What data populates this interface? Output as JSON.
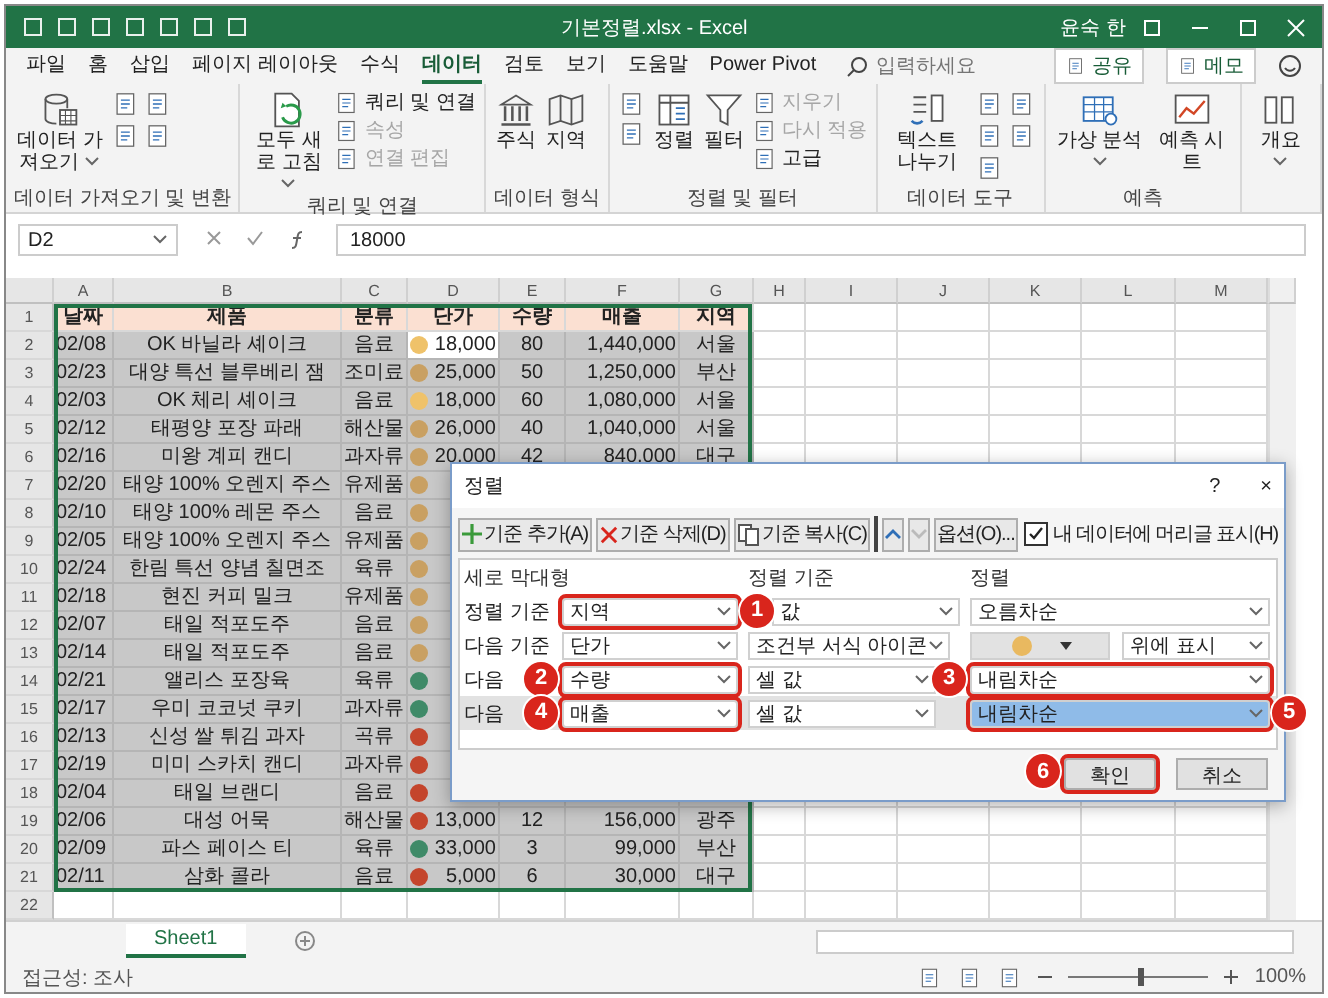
{
  "window": {
    "title": "기본정렬.xlsx - Excel",
    "user": "윤숙 한"
  },
  "ribbon_tabs": [
    {
      "label": "파일",
      "selected": false
    },
    {
      "label": "홈",
      "selected": false
    },
    {
      "label": "삽입",
      "selected": false
    },
    {
      "label": "페이지 레이아웃",
      "selected": false
    },
    {
      "label": "수식",
      "selected": false
    },
    {
      "label": "데이터",
      "selected": true
    },
    {
      "label": "검토",
      "selected": false
    },
    {
      "label": "보기",
      "selected": false
    },
    {
      "label": "도움말",
      "selected": false
    },
    {
      "label": "Power Pivot",
      "selected": false
    }
  ],
  "search": {
    "placeholder": "입력하세요"
  },
  "share_button": "공유",
  "memo_button": "메모",
  "ribbon_groups": [
    {
      "label": "데이터 가져오기 및 변환",
      "items": [
        {
          "label": "데이터 가져오기",
          "kind": "large",
          "dropdown": true,
          "disabled": false
        }
      ]
    },
    {
      "label": "쿼리 및 연결",
      "items": [
        {
          "label": "모두 새로 고침",
          "kind": "large",
          "dropdown": true,
          "disabled": false
        },
        {
          "label": "쿼리 및 연결",
          "kind": "small",
          "disabled": false
        },
        {
          "label": "속성",
          "kind": "small",
          "disabled": true
        },
        {
          "label": "연결 편집",
          "kind": "small",
          "disabled": true
        }
      ]
    },
    {
      "label": "데이터 형식",
      "items": [
        {
          "label": "주식",
          "kind": "large",
          "dropdown": false,
          "disabled": false
        },
        {
          "label": "지역",
          "kind": "large",
          "dropdown": false,
          "disabled": false
        }
      ]
    },
    {
      "label": "정렬 및 필터",
      "items": [
        {
          "label": "정렬",
          "kind": "large",
          "dropdown": false,
          "disabled": false
        },
        {
          "label": "필터",
          "kind": "large",
          "dropdown": false,
          "disabled": false
        },
        {
          "label": "지우기",
          "kind": "small",
          "disabled": true
        },
        {
          "label": "다시 적용",
          "kind": "small",
          "disabled": true
        },
        {
          "label": "고급",
          "kind": "small",
          "disabled": false
        }
      ]
    },
    {
      "label": "데이터 도구",
      "items": [
        {
          "label": "텍스트 나누기",
          "kind": "large",
          "dropdown": false,
          "disabled": false
        }
      ]
    },
    {
      "label": "예측",
      "items": [
        {
          "label": "가상 분석",
          "kind": "large",
          "dropdown": true,
          "disabled": false
        },
        {
          "label": "예측 시트",
          "kind": "large",
          "dropdown": false,
          "disabled": false
        }
      ]
    },
    {
      "items": [
        {
          "label": "개요",
          "kind": "large",
          "dropdown": true,
          "disabled": false
        }
      ]
    }
  ],
  "formula_bar": {
    "name_box": "D2",
    "formula": "18000"
  },
  "sheet": {
    "columns": [
      "A",
      "B",
      "C",
      "D",
      "E",
      "F",
      "G",
      "H",
      "I",
      "J",
      "K",
      "L",
      "M"
    ],
    "row_numbers": [
      "1",
      "2",
      "3",
      "4",
      "5",
      "6",
      "7",
      "8",
      "9",
      "10",
      "11",
      "12",
      "13",
      "14",
      "15",
      "16",
      "17",
      "18",
      "19",
      "20",
      "21",
      "22"
    ],
    "header": [
      "날짜",
      "제품",
      "분류",
      "단가",
      "수량",
      "매출",
      "지역"
    ],
    "rows": [
      {
        "cells": [
          "02/08",
          "OK 바닐라 셰이크",
          "음료",
          "18,000",
          "80",
          "1,440,000",
          "서울"
        ],
        "color": "#efc26a",
        "active": true
      },
      {
        "cells": [
          "02/23",
          "대양 특선 블루베리 잼",
          "조미료",
          "25,000",
          "50",
          "1,250,000",
          "부산"
        ],
        "color": "#c9a062",
        "active": false
      },
      {
        "cells": [
          "02/03",
          "OK 체리 셰이크",
          "음료",
          "18,000",
          "60",
          "1,080,000",
          "서울"
        ],
        "color": "#efc26a",
        "active": false
      },
      {
        "cells": [
          "02/12",
          "태평양 포장 파래",
          "해산물",
          "26,000",
          "40",
          "1,040,000",
          "서울"
        ],
        "color": "#c9a062",
        "active": false
      },
      {
        "cells": [
          "02/16",
          "미왕 계피 캔디",
          "과자류",
          "20,000",
          "42",
          "840,000",
          "대구"
        ],
        "color": "#c9a062",
        "active": false
      },
      {
        "cells": [
          "02/20",
          "태양 100% 오렌지 주스",
          "유제품"
        ],
        "color": "#c9a062",
        "active": false
      },
      {
        "cells": [
          "02/10",
          "태양 100% 레몬 주스",
          "음료"
        ],
        "color": "#c9a062",
        "active": false
      },
      {
        "cells": [
          "02/05",
          "태양 100% 오렌지 주스",
          "유제품"
        ],
        "color": "#c9a062",
        "active": false
      },
      {
        "cells": [
          "02/24",
          "한림 특선 양념 칠면조",
          "육류"
        ],
        "color": "#c9a062",
        "active": false
      },
      {
        "cells": [
          "02/18",
          "현진 커피 밀크",
          "유제품"
        ],
        "color": "#c9a062",
        "active": false
      },
      {
        "cells": [
          "02/07",
          "태일 적포도주",
          "음료"
        ],
        "color": "#c9a062",
        "active": false
      },
      {
        "cells": [
          "02/14",
          "태일 적포도주",
          "음료"
        ],
        "color": "#c9a062",
        "active": false
      },
      {
        "cells": [
          "02/21",
          "앨리스 포장육",
          "육류"
        ],
        "color": "#3f8a68",
        "active": false
      },
      {
        "cells": [
          "02/17",
          "우미 코코넛 쿠키",
          "과자류"
        ],
        "color": "#3f8a68",
        "active": false
      },
      {
        "cells": [
          "02/13",
          "신성 쌀 튀김 과자",
          "곡류"
        ],
        "color": "#c4452c",
        "active": false
      },
      {
        "cells": [
          "02/19",
          "미미 스카치 캔디",
          "과자류"
        ],
        "color": "#c4452c",
        "active": false
      },
      {
        "cells": [
          "02/04",
          "태일 브랜디",
          "음료"
        ],
        "color": "#c4452c",
        "active": false
      },
      {
        "cells": [
          "02/06",
          "대성 어묵",
          "해산물",
          "13,000",
          "12",
          "156,000",
          "광주"
        ],
        "color": "#c4452c",
        "active": false
      },
      {
        "cells": [
          "02/09",
          "파스 페이스 티",
          "육류",
          "33,000",
          "3",
          "99,000",
          "부산"
        ],
        "color": "#3f8a68",
        "active": false
      },
      {
        "cells": [
          "02/11",
          "삼화 콜라",
          "음료",
          "5,000",
          "6",
          "30,000",
          "대구"
        ],
        "color": "#c4452c",
        "active": false
      }
    ]
  },
  "dialog": {
    "title": "정렬",
    "help": "?",
    "close": "×",
    "toolbar": [
      {
        "kind": "add",
        "label": "기준 추가(A)",
        "disabled": false
      },
      {
        "kind": "delete",
        "label": "기준 삭제(D)",
        "disabled": false
      },
      {
        "kind": "copy",
        "label": "기준 복사(C)",
        "disabled": false
      },
      {
        "kind": "up",
        "disabled": false
      },
      {
        "kind": "down",
        "disabled": true
      },
      {
        "kind": "text",
        "label": "옵션(O)...",
        "disabled": false
      }
    ],
    "header_checkbox": {
      "label": "내 데이터에 머리글 표시(H)",
      "checked": true
    },
    "columns": [
      "세로 막대형",
      "정렬 기준",
      "정렬"
    ],
    "levels": [
      {
        "label": "정렬 기준",
        "selected": false,
        "column": {
          "value": "지역",
          "highlighted": true,
          "badge": "1"
        },
        "sort_on": {
          "value": "값"
        },
        "order": {
          "kind": "text",
          "value": "오름차순",
          "highlighted": false,
          "selected": false
        }
      },
      {
        "label": "다음 기준",
        "selected": false,
        "column": {
          "value": "단가",
          "highlighted": false
        },
        "sort_on": {
          "value": "조건부 서식 아이콘"
        },
        "order": {
          "kind": "icon",
          "color": "#e9b960",
          "position": "위에 표시",
          "highlighted": false,
          "selected": false
        }
      },
      {
        "label": "다음",
        "selected": false,
        "column": {
          "value": "수량",
          "highlighted": true,
          "badge": "2"
        },
        "sort_on": {
          "value": "셀 값"
        },
        "order": {
          "kind": "text",
          "value": "내림차순",
          "highlighted": true,
          "selected": false,
          "badge": "3"
        }
      },
      {
        "label": "다음",
        "selected": true,
        "column": {
          "value": "매출",
          "highlighted": true,
          "badge": "4"
        },
        "sort_on": {
          "value": "셀 값"
        },
        "order": {
          "kind": "text",
          "value": "내림차순",
          "highlighted": true,
          "selected": true,
          "badge": "5"
        }
      }
    ],
    "buttons": [
      {
        "label": "확인",
        "highlighted": true,
        "badge": "6"
      },
      {
        "label": "취소",
        "highlighted": false
      }
    ]
  },
  "sheet_tabs": [
    {
      "label": "Sheet1",
      "selected": true
    }
  ],
  "status_bar": {
    "text": "접근성: 조사",
    "zoom": "100%",
    "level": 0.5
  }
}
